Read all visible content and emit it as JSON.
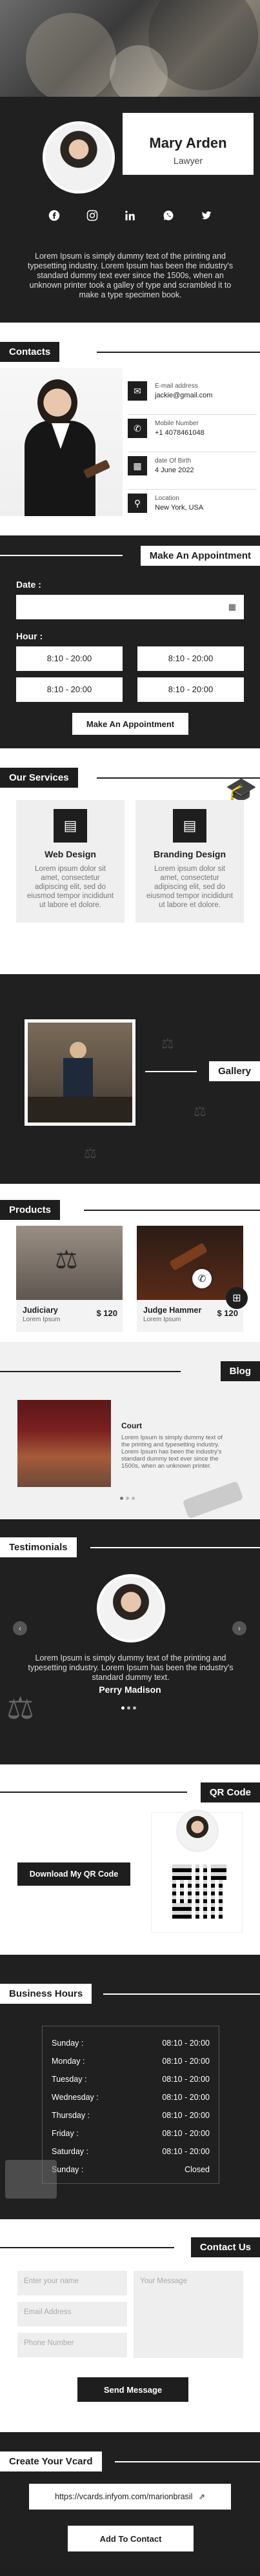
{
  "profile": {
    "name": "Mary Arden",
    "job_title": "Lawyer",
    "bio": "Lorem Ipsum is simply dummy text of the printing and typesetting industry. Lorem Ipsum has been the industry's standard dummy text ever since the 1500s, when an unknown printer took a galley of type and scrambled it to make a type specimen book.",
    "socials": [
      "facebook-icon",
      "instagram-icon",
      "linkedin-icon",
      "whatsapp-icon",
      "twitter-icon"
    ]
  },
  "contacts": {
    "heading": "Contacts",
    "items": [
      {
        "icon": "mail-icon",
        "label": "E-mail address",
        "value": "jackie@gmail.com"
      },
      {
        "icon": "phone-icon",
        "label": "Mobile Number",
        "value": "+1 4078461048"
      },
      {
        "icon": "calendar-icon",
        "label": "date Of Birth",
        "value": "4 June 2022"
      },
      {
        "icon": "location-icon",
        "label": "Location",
        "value": "New York, USA"
      }
    ]
  },
  "appointment": {
    "heading": "Make An Appointment",
    "date_label": "Date :",
    "hour_label": "Hour :",
    "slots": [
      "8:10 - 20:00",
      "8:10 - 20:00",
      "8:10 - 20:00",
      "8:10 - 20:00"
    ],
    "button": "Make An Appointment"
  },
  "services": {
    "heading": "Our Services",
    "items": [
      {
        "title": "Web Design",
        "text": "Lorem ipsum dolor sit amet, consectetur adipiscing elit, sed do eiusmod tempor incididunt ut labore et dolore."
      },
      {
        "title": "Branding Design",
        "text": "Lorem ipsum dolor sit amet, consectetur adipiscing elit, sed do eiusmod tempor incididunt ut labore et dolore."
      }
    ]
  },
  "gallery": {
    "heading": "Gallery"
  },
  "products": {
    "heading": "Products",
    "items": [
      {
        "name": "Judiciary",
        "desc": "Lorem Ipsum",
        "price": "$ 120"
      },
      {
        "name": "Judge Hammer",
        "desc": "Lorem Ipsum",
        "price": "$ 120"
      }
    ]
  },
  "blog": {
    "heading": "Blog",
    "title": "Court",
    "text": "Lorem Ipsum is simply dummy text of the printing and typesetting industry. Lorem Ipsum has been the industry's standard dummy text ever since the 1500s, when an unknown printer."
  },
  "testimonials": {
    "heading": "Testimonials",
    "text": "Lorem Ipsum is simply dummy text of the printing and typesetting industry. Lorem Ipsum has been the industry's standard dummy text.",
    "name": "Perry Madison"
  },
  "qr": {
    "heading": "QR Code",
    "button": "Download My QR Code"
  },
  "hours": {
    "heading": "Business Hours",
    "rows": [
      {
        "day": "Sunday :",
        "time": "08:10 - 20:00"
      },
      {
        "day": "Monday :",
        "time": "08:10 - 20:00"
      },
      {
        "day": "Tuesday :",
        "time": "08:10 - 20:00"
      },
      {
        "day": "Wednesday :",
        "time": "08:10 - 20:00"
      },
      {
        "day": "Thursday :",
        "time": "08:10 - 20:00"
      },
      {
        "day": "Friday :",
        "time": "08:10 - 20:00"
      },
      {
        "day": "Saturday :",
        "time": "08:10 - 20:00"
      },
      {
        "day": "Sunday :",
        "time": "Closed"
      }
    ]
  },
  "contact_us": {
    "heading": "Contact Us",
    "name_placeholder": "Enter your name",
    "message_placeholder": "Your Message",
    "email_placeholder": "Email Address",
    "phone_placeholder": "Phone Number",
    "button": "Send Message"
  },
  "vcard": {
    "heading": "Create Your Vcard",
    "link": "https://vcards.infyom.com/marionbrasil",
    "button": "Add To Contact"
  },
  "colors": {
    "dark": "#202020",
    "panel": "#1e1e1e",
    "light": "#ffffff"
  }
}
